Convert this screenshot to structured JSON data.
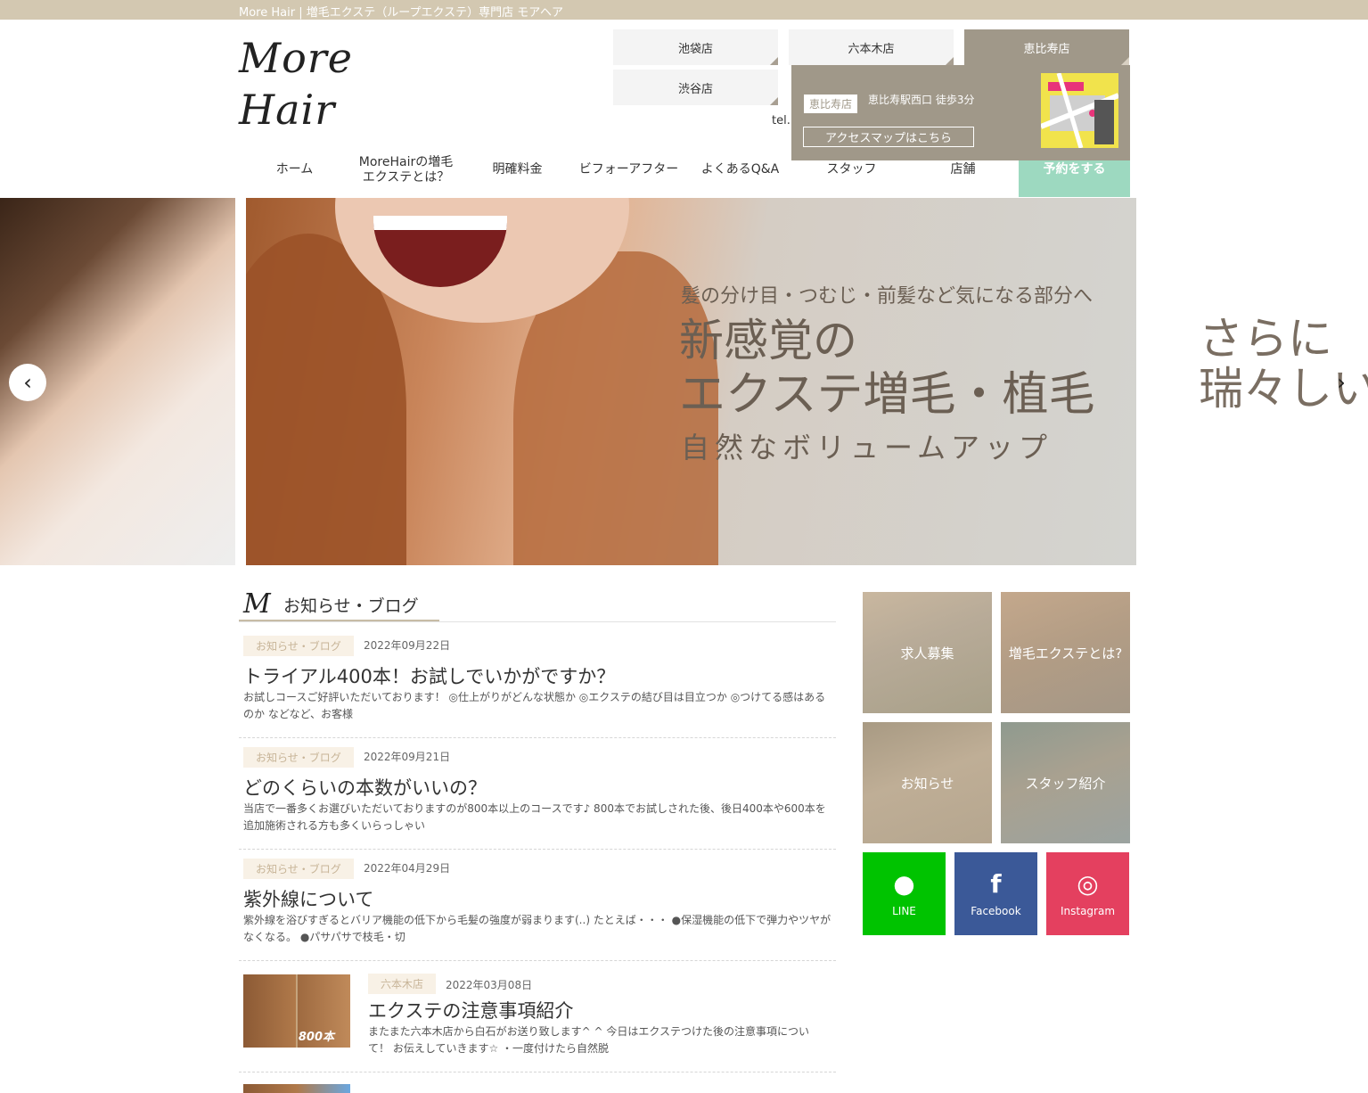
{
  "site": {
    "tagline": "More Hair | 増毛エクステ（ループエクステ）専門店 モアヘア",
    "logo_text": "More Hair"
  },
  "stores": [
    {
      "label": "池袋店"
    },
    {
      "label": "六本木店"
    },
    {
      "label": "恵比寿店"
    },
    {
      "label": "渋谷店"
    }
  ],
  "tel_label": "tel.",
  "dropdown": {
    "badge": "恵比寿店",
    "access": "恵比寿駅西口 徒歩3分",
    "map_link": "アクセスマップはこちら"
  },
  "nav": {
    "items": [
      {
        "label": "ホーム"
      },
      {
        "label": "MoreHairの増毛エクステとは？"
      },
      {
        "label": "明確料金"
      },
      {
        "label": "ビフォーアフター"
      },
      {
        "label": "よくあるQ&A"
      },
      {
        "label": "スタッフ"
      },
      {
        "label": "店舗"
      },
      {
        "label": "予約をする"
      }
    ]
  },
  "hero": {
    "subtitle": "髪の分け目・つむじ・前髪など気になる部分へ",
    "title_line1": "新感覚の",
    "title_line2": "エクステ増毛・植毛",
    "title_line3": "自然なボリュームアップ",
    "next_slide_line1": "さらに",
    "next_slide_line2": "瑞々しい",
    "prev_arrow": "‹",
    "next_arrow": "›"
  },
  "news": {
    "heading": "お知らせ・ブログ",
    "heading_icon": "M",
    "posts": [
      {
        "category": "お知らせ・ブログ",
        "date": "2022年09月22日",
        "title": "トライアル400本！お試しでいかがですか？",
        "excerpt": "お試しコースご好評いただいております！ ◎仕上がりがどんな状態か ◎エクステの結び目は目立つか ◎つけてる感はあるのか などなど、お客様"
      },
      {
        "category": "お知らせ・ブログ",
        "date": "2022年09月21日",
        "title": "どのくらいの本数がいいの？",
        "excerpt": "当店で一番多くお選びいただいておりますのが800本以上のコースです♪ 800本でお試しされた後、後日400本や600本を追加施術される方も多くいらっしゃい"
      },
      {
        "category": "お知らせ・ブログ",
        "date": "2022年04月29日",
        "title": "紫外線について",
        "excerpt": "紫外線を浴びすぎるとバリア機能の低下から毛髪の強度が弱まります(..) たとえば・・・ ●保湿機能の低下で弾力やツヤがなくなる。 ●パサパサで枝毛・切"
      },
      {
        "category": "六本木店",
        "date": "2022年03月08日",
        "title": "エクステの注意事項紹介",
        "excerpt": "またまた六本木店から白石がお送り致します^ ^ 今日はエクステつけた後の注意事項について！ お伝えしていきます☆ ・一度付けたら自然脱",
        "thumb_label": "800本"
      }
    ]
  },
  "sidebar": {
    "tiles": [
      {
        "label": "求人募集"
      },
      {
        "label": "増毛エクステとは?"
      },
      {
        "label": "お知らせ"
      },
      {
        "label": "スタッフ紹介"
      }
    ],
    "social": [
      {
        "label": "LINE",
        "icon": "speech-bubble-icon",
        "glyph": "●",
        "color": "#00c300"
      },
      {
        "label": "Facebook",
        "icon": "facebook-icon",
        "glyph": "f",
        "color": "#3b5998"
      },
      {
        "label": "Instagram",
        "icon": "instagram-icon",
        "glyph": "◎",
        "color": "#e4405f"
      }
    ]
  },
  "colors": {
    "topbar": "#d3c8b1",
    "accent": "#a09889",
    "reserve": "#9dd9c0"
  }
}
